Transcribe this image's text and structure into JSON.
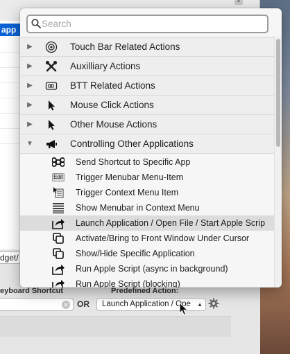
{
  "app": {
    "selected_row_label": "app",
    "widget_field_value": "dget/",
    "keyboard_shortcut_label": "eyboard Shortcut",
    "or_label": "OR",
    "predefined_action_label": "Predefined Action:",
    "predefined_action_value": "Launch Application / Ope",
    "clear_icon": "clear-icon",
    "gear_icon": "gear-icon"
  },
  "popup": {
    "search_placeholder": "Search",
    "categories": [
      {
        "label": "Touch Bar Related Actions",
        "icon": "touchbar-icon",
        "expanded": false
      },
      {
        "label": "Auxilliary Actions",
        "icon": "tools-icon",
        "expanded": false
      },
      {
        "label": "BTT Related Actions",
        "icon": "btt-icon",
        "expanded": false
      },
      {
        "label": "Mouse Click Actions",
        "icon": "mouse-pointer-icon",
        "expanded": false
      },
      {
        "label": "Other Mouse Actions",
        "icon": "mouse-pointer-icon",
        "expanded": false
      },
      {
        "label": "Controlling Other Applications",
        "icon": "megaphone-icon",
        "expanded": true
      }
    ],
    "sub_items": [
      {
        "label": "Send Shortcut to Specific App",
        "icon": "command-icon"
      },
      {
        "label": "Trigger Menubar Menu-Item",
        "icon": "edit-menu-icon",
        "icon_text": "Edit"
      },
      {
        "label": "Trigger Context Menu Item",
        "icon": "context-menu-icon"
      },
      {
        "label": "Show Menubar in Context Menu",
        "icon": "lines-icon"
      },
      {
        "label": "Launch Application / Open File / Start Apple Scrip",
        "icon": "share-arrow-icon",
        "selected": true
      },
      {
        "label": "Activate/Bring to Front Window Under Cursor",
        "icon": "windows-icon"
      },
      {
        "label": "Show/Hide Specific Application",
        "icon": "windows-icon"
      },
      {
        "label": "Run Apple Script (async in background)",
        "icon": "share-arrow-icon"
      },
      {
        "label": "Run Apple Script (blocking)",
        "icon": "share-arrow-icon"
      }
    ]
  }
}
